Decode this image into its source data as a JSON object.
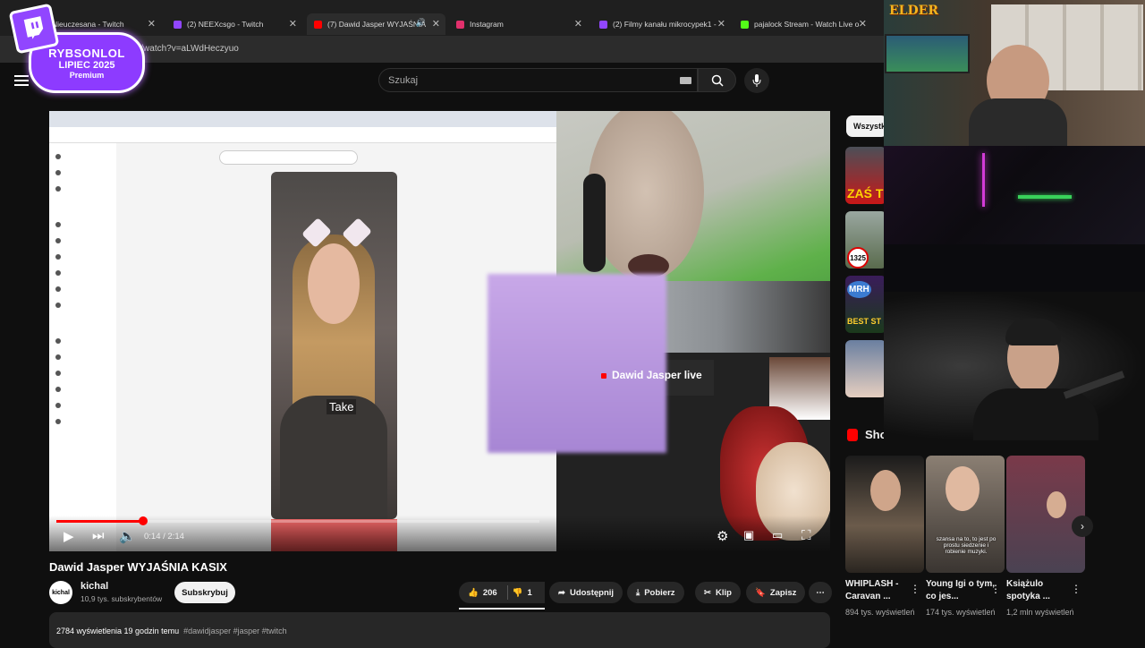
{
  "tabs": [
    {
      "label": "Nieuczesana - Twitch",
      "icon": "twitch-icon",
      "color": "#9146ff"
    },
    {
      "label": "(2) NEEXcsgo - Twitch",
      "icon": "twitch-icon",
      "color": "#9146ff"
    },
    {
      "label": "(7) Dawid Jasper WYJAŚNIA",
      "icon": "youtube-icon",
      "color": "#ff0000"
    },
    {
      "label": "Instagram",
      "icon": "instagram-icon",
      "color": "#e1306c"
    },
    {
      "label": "(2) Filmy kanału mikrocypek1 -",
      "icon": "twitch-icon",
      "color": "#9146ff"
    },
    {
      "label": "pajalock Stream - Watch Live o",
      "icon": "kick-icon",
      "color": "#53fc18"
    }
  ],
  "address": "youtube.com/watch?v=aLWdHeczyuo",
  "badge": {
    "name": "RYBSONLOL",
    "date": "LIPIEC 2025",
    "premium": "Premium"
  },
  "search": {
    "placeholder": "Szukaj"
  },
  "player": {
    "time": "0:14 / 2:14",
    "progress_fraction": 0.18,
    "overlay_caption": "Take",
    "inner_channel_label": "Dawid Jasper live"
  },
  "video": {
    "title": "Dawid Jasper WYJAŚNIA KASIX",
    "channel": "kichal",
    "avatar_text": "kichal",
    "subscribers": "10,9 tys. subskrybentów",
    "subscribe_label": "Subskrybuj",
    "likes": "206",
    "dislikes": "1",
    "share_label": "Udostępnij",
    "download_label": "Pobierz",
    "clip_label": "Klip",
    "save_label": "Zapisz",
    "views_line": "2784 wyświetlenia  19 godzin temu",
    "tags": "#dawidjasper #jasper #twitch"
  },
  "right": {
    "chip_label": "Wszystk",
    "shorts_title": "Sho",
    "shorts": [
      {
        "title": "WHIPLASH - Caravan ...",
        "views": "894 tys. wyświetleń"
      },
      {
        "title": "Young Igi o tym,  co jes...",
        "views": "174 tys. wyświetleń",
        "overlay": "szansa na to, to jest po prostu siedzenie i robienie muzyki."
      },
      {
        "title": "Książulo spotyka ...",
        "views": "1,2 mln wyświetleń"
      }
    ],
    "thumb_texts": [
      "ZAŚ TE",
      "1325",
      "MRH",
      "BEST ST"
    ]
  },
  "webcam": {
    "logo": "ELDER"
  },
  "colors": {
    "accent": "#ff0000",
    "twitch": "#9146ff",
    "bg": "#0f0f0f"
  }
}
